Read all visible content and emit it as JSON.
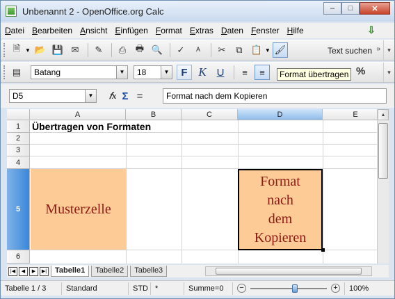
{
  "window": {
    "title": "Unbenannt 2 - OpenOffice.org Calc",
    "buttons": {
      "minimize": "–",
      "maximize": "□",
      "close": "✕"
    }
  },
  "menu": [
    "Datei",
    "Bearbeiten",
    "Ansicht",
    "Einfügen",
    "Format",
    "Extras",
    "Daten",
    "Fenster",
    "Hilfe"
  ],
  "toolbar1": {
    "find_label": "Text suchen"
  },
  "toolbar2": {
    "font_name": "Batang",
    "font_size": "18",
    "bold": "F",
    "italic": "K",
    "underline": "U",
    "percent": "%"
  },
  "tooltip": "Format übertragen",
  "formula_bar": {
    "name_box": "D5",
    "fx": "𝑓x",
    "sigma": "Σ",
    "equals": "=",
    "content": "Format nach dem Kopieren"
  },
  "columns": [
    "A",
    "B",
    "C",
    "D",
    "E"
  ],
  "selected_column": "D",
  "rows": [
    "1",
    "2",
    "3",
    "4",
    "5",
    "6"
  ],
  "selected_row": "5",
  "cells": {
    "A1": "Übertragen von Formaten",
    "A5": "Musterzelle",
    "D5_lines": [
      "Format",
      "nach",
      "dem",
      "Kopieren"
    ]
  },
  "cell_fill_color": "#fdcb96",
  "cell_text_color": "#8e1a14",
  "sheet_tabs": [
    "Tabelle1",
    "Tabelle2",
    "Tabelle3"
  ],
  "active_sheet": "Tabelle1",
  "status": {
    "sheet": "Tabelle 1 / 3",
    "style": "Standard",
    "mode": "STD",
    "modified": "*",
    "sum": "Summe=0",
    "zoom": "100%",
    "zoom_minus": "−",
    "zoom_plus": "+"
  }
}
